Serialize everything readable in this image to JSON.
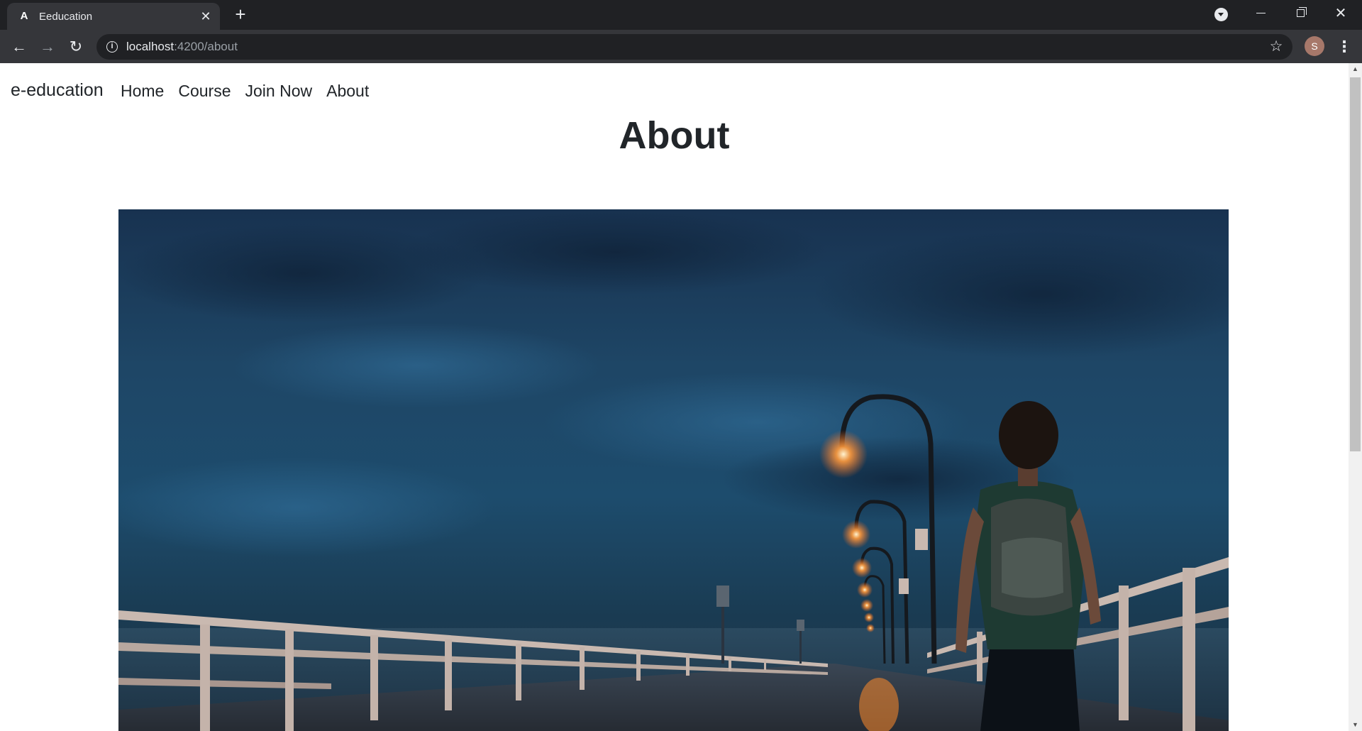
{
  "browser": {
    "tab": {
      "title": "Eeducation",
      "favicon": "A"
    },
    "address": {
      "host": "localhost",
      "path": ":4200/about"
    },
    "profile_initial": "S",
    "icons": {
      "tab_close": "close-icon",
      "new_tab": "plus-icon",
      "tab_search": "tab-search-icon",
      "back": "arrow-left-icon",
      "forward": "arrow-right-icon",
      "reload": "reload-icon",
      "site_info": "info-icon",
      "bookmark": "star-icon",
      "menu": "kebab-menu-icon"
    }
  },
  "navbar": {
    "brand": "e-education",
    "links": [
      {
        "label": "Home"
      },
      {
        "label": "Course"
      },
      {
        "label": "Join Now"
      },
      {
        "label": "About"
      }
    ]
  },
  "main": {
    "heading": "About"
  },
  "colors": {
    "chrome_dark": "#202124",
    "chrome_toolbar": "#35363a",
    "text": "#212529",
    "lamp_glow": "#ff9a3c"
  }
}
